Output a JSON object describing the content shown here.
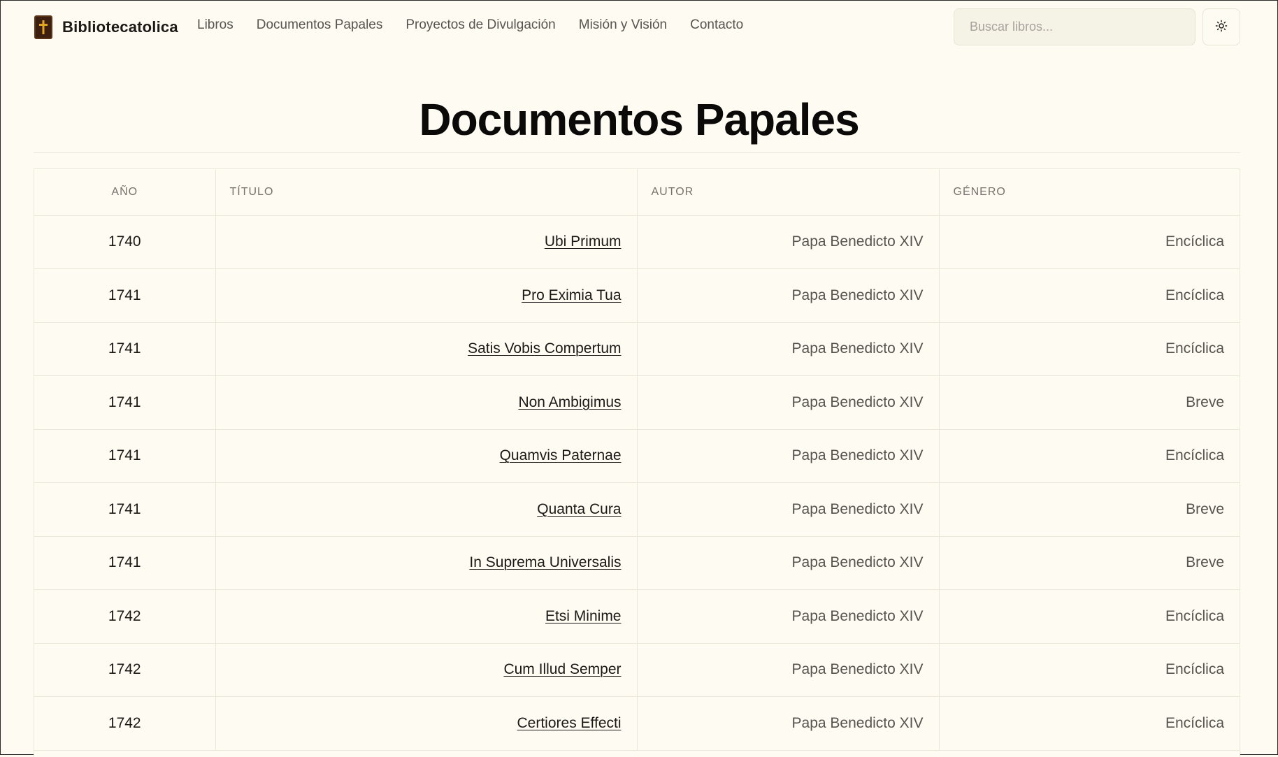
{
  "header": {
    "brand": "Bibliotecatolica",
    "logo_icon": "cross-book-icon",
    "nav": [
      {
        "label": "Libros"
      },
      {
        "label": "Documentos Papales"
      },
      {
        "label": "Proyectos de Divulgación"
      },
      {
        "label": "Misión y Visión"
      },
      {
        "label": "Contacto"
      }
    ],
    "search": {
      "placeholder": "Buscar libros...",
      "value": ""
    },
    "theme_toggle_icon": "sun-icon"
  },
  "page": {
    "title": "Documentos Papales"
  },
  "table": {
    "columns": [
      "AÑO",
      "TÍTULO",
      "AUTOR",
      "GÉNERO"
    ],
    "rows": [
      {
        "year": "1740",
        "title": "Ubi Primum",
        "author": "Papa Benedicto XIV",
        "genre": "Encíclica"
      },
      {
        "year": "1741",
        "title": "Pro Eximia Tua",
        "author": "Papa Benedicto XIV",
        "genre": "Encíclica"
      },
      {
        "year": "1741",
        "title": "Satis Vobis Compertum",
        "author": "Papa Benedicto XIV",
        "genre": "Encíclica"
      },
      {
        "year": "1741",
        "title": "Non Ambigimus",
        "author": "Papa Benedicto XIV",
        "genre": "Breve"
      },
      {
        "year": "1741",
        "title": "Quamvis Paternae",
        "author": "Papa Benedicto XIV",
        "genre": "Encíclica"
      },
      {
        "year": "1741",
        "title": "Quanta Cura",
        "author": "Papa Benedicto XIV",
        "genre": "Breve"
      },
      {
        "year": "1741",
        "title": "In Suprema Universalis",
        "author": "Papa Benedicto XIV",
        "genre": "Breve"
      },
      {
        "year": "1742",
        "title": "Etsi Minime",
        "author": "Papa Benedicto XIV",
        "genre": "Encíclica"
      },
      {
        "year": "1742",
        "title": "Cum Illud Semper",
        "author": "Papa Benedicto XIV",
        "genre": "Encíclica"
      },
      {
        "year": "1742",
        "title": "Certiores Effecti",
        "author": "Papa Benedicto XIV",
        "genre": "Encíclica"
      }
    ]
  },
  "colors": {
    "background": "#fdfbf2",
    "text": "#1c1917",
    "muted": "#57534e",
    "border": "#ebe7da",
    "logo": "#3d1f0f",
    "logo_cross": "#e0a526"
  }
}
